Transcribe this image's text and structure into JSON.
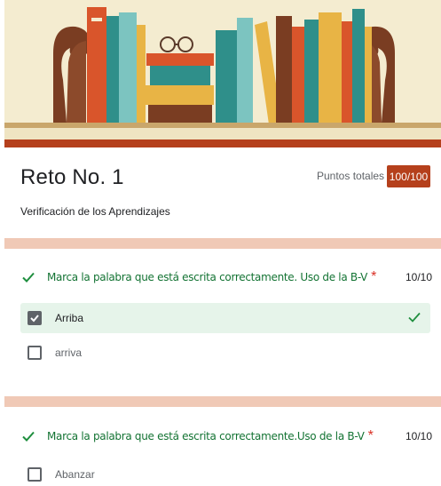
{
  "form": {
    "title": "Reto No. 1",
    "description": "Verificación de los Aprendizajes",
    "points_label": "Puntos totales",
    "points_value": "100/100"
  },
  "questions": [
    {
      "text": "Marca la palabra que está escrita correctamente. Uso de la B-V",
      "required_mark": "*",
      "score": "10/10",
      "options": [
        {
          "label": "Arriba",
          "checked": true,
          "correct": true
        },
        {
          "label": "arriva",
          "checked": false,
          "correct": false
        }
      ]
    },
    {
      "text": "Marca la palabra que está escrita correctamente.Uso de la B-V",
      "required_mark": "*",
      "score": "10/10",
      "options": [
        {
          "label": "Abanzar",
          "checked": false,
          "correct": false
        }
      ]
    }
  ],
  "colors": {
    "accent": "#b5401c",
    "correct_green": "#137333",
    "band": "#f0c9b6"
  },
  "icons": [
    "bookshelf-banner",
    "checkmark-icon",
    "checkbox-checked-icon",
    "checkbox-empty-icon"
  ]
}
